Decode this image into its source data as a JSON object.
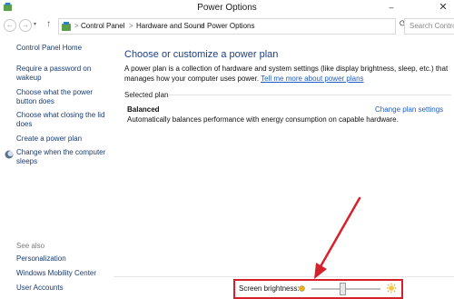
{
  "window": {
    "title": "Power Options"
  },
  "address_bar": {
    "breadcrumbs": [
      "Control Panel",
      "Hardware and Sound",
      "Power Options"
    ],
    "separator": ">",
    "search_placeholder": "Search Control"
  },
  "sidebar": {
    "home": "Control Panel Home",
    "tasks": [
      "Require a password on wakeup",
      "Choose what the power button does",
      "Choose what closing the lid does",
      "Create a power plan",
      "Change when the computer sleeps"
    ],
    "see_also_label": "See also",
    "see_also": [
      "Personalization",
      "Windows Mobility Center",
      "User Accounts"
    ]
  },
  "main": {
    "heading": "Choose or customize a power plan",
    "description": "A power plan is a collection of hardware and system settings (like display brightness, sleep, etc.) that manages how your computer uses power.",
    "learn_more": "Tell me more about power plans",
    "selected_plan_label": "Selected plan",
    "plan": {
      "name": "Balanced",
      "description": "Automatically balances performance with energy consumption on capable hardware.",
      "change_link": "Change plan settings"
    }
  },
  "bottom": {
    "brightness_label": "Screen brightness:",
    "brightness_level": 0.45
  },
  "colors": {
    "link": "#1e5bc7",
    "heading": "#1e3f87",
    "highlight": "#d6212b"
  }
}
